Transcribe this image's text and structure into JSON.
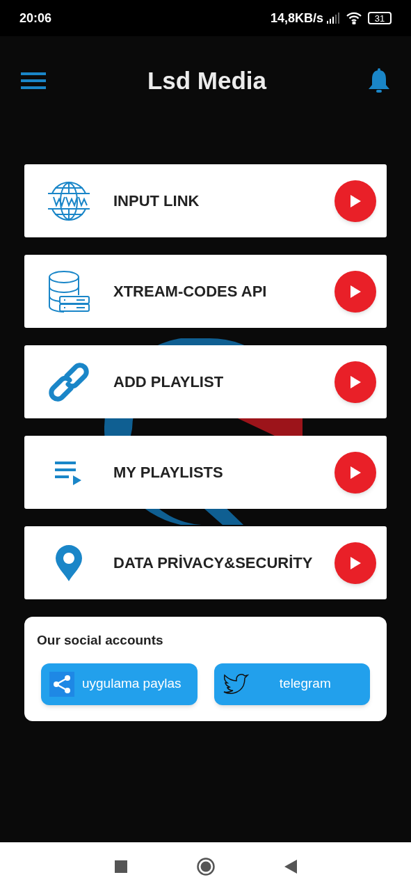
{
  "status_bar": {
    "time": "20:06",
    "net_speed": "14,8KB/s",
    "battery": "31"
  },
  "app_bar": {
    "title": "Lsd Media"
  },
  "menu": [
    {
      "label": "INPUT LINK"
    },
    {
      "label": "XTREAM-CODES API"
    },
    {
      "label": "ADD PLAYLIST"
    },
    {
      "label": "MY PLAYLISTS"
    },
    {
      "label": "DATA PRİVACY&SECURİTY"
    }
  ],
  "social": {
    "title": "Our social accounts",
    "buttons": [
      {
        "label": "uygulama paylas"
      },
      {
        "label": "telegram"
      }
    ]
  }
}
